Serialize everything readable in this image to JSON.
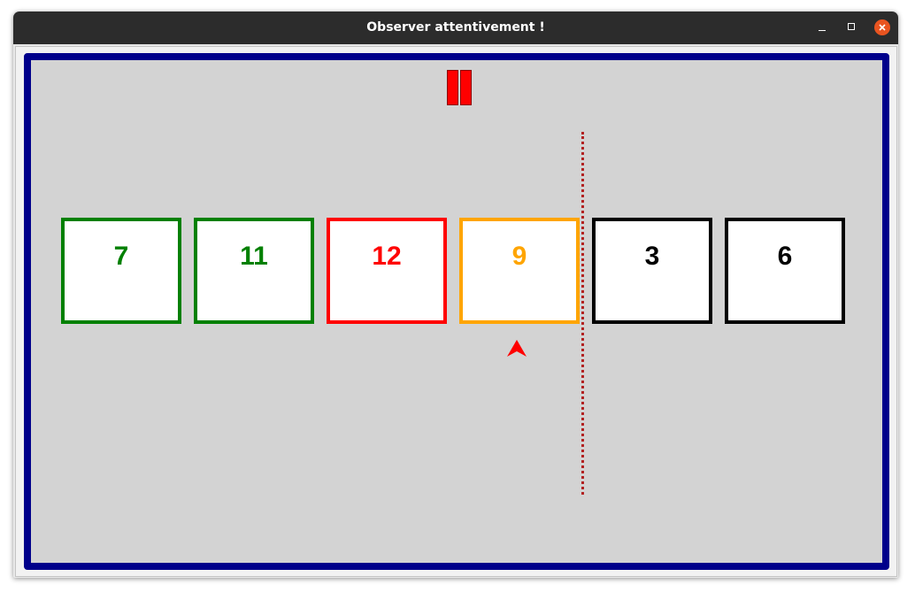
{
  "window": {
    "title": "Observer attentivement !"
  },
  "controls": {
    "minimize_icon": "minimize-icon",
    "maximize_icon": "maximize-icon",
    "close_icon": "close-icon",
    "close_color": "#e95420"
  },
  "game": {
    "frame_color": "#00008b",
    "background_color": "#d3d3d3",
    "pause_icon": "pause-icon",
    "pause_color": "#ff0000",
    "separator_color": "#b22222",
    "marker_icon": "arrow-up-icon",
    "marker_color": "#ff0000",
    "cards": [
      {
        "value": "7",
        "color": "#008000"
      },
      {
        "value": "11",
        "color": "#008000"
      },
      {
        "value": "12",
        "color": "#ff0000"
      },
      {
        "value": "9",
        "color": "#ffa500"
      },
      {
        "value": "3",
        "color": "#000000"
      },
      {
        "value": "6",
        "color": "#000000"
      }
    ]
  }
}
